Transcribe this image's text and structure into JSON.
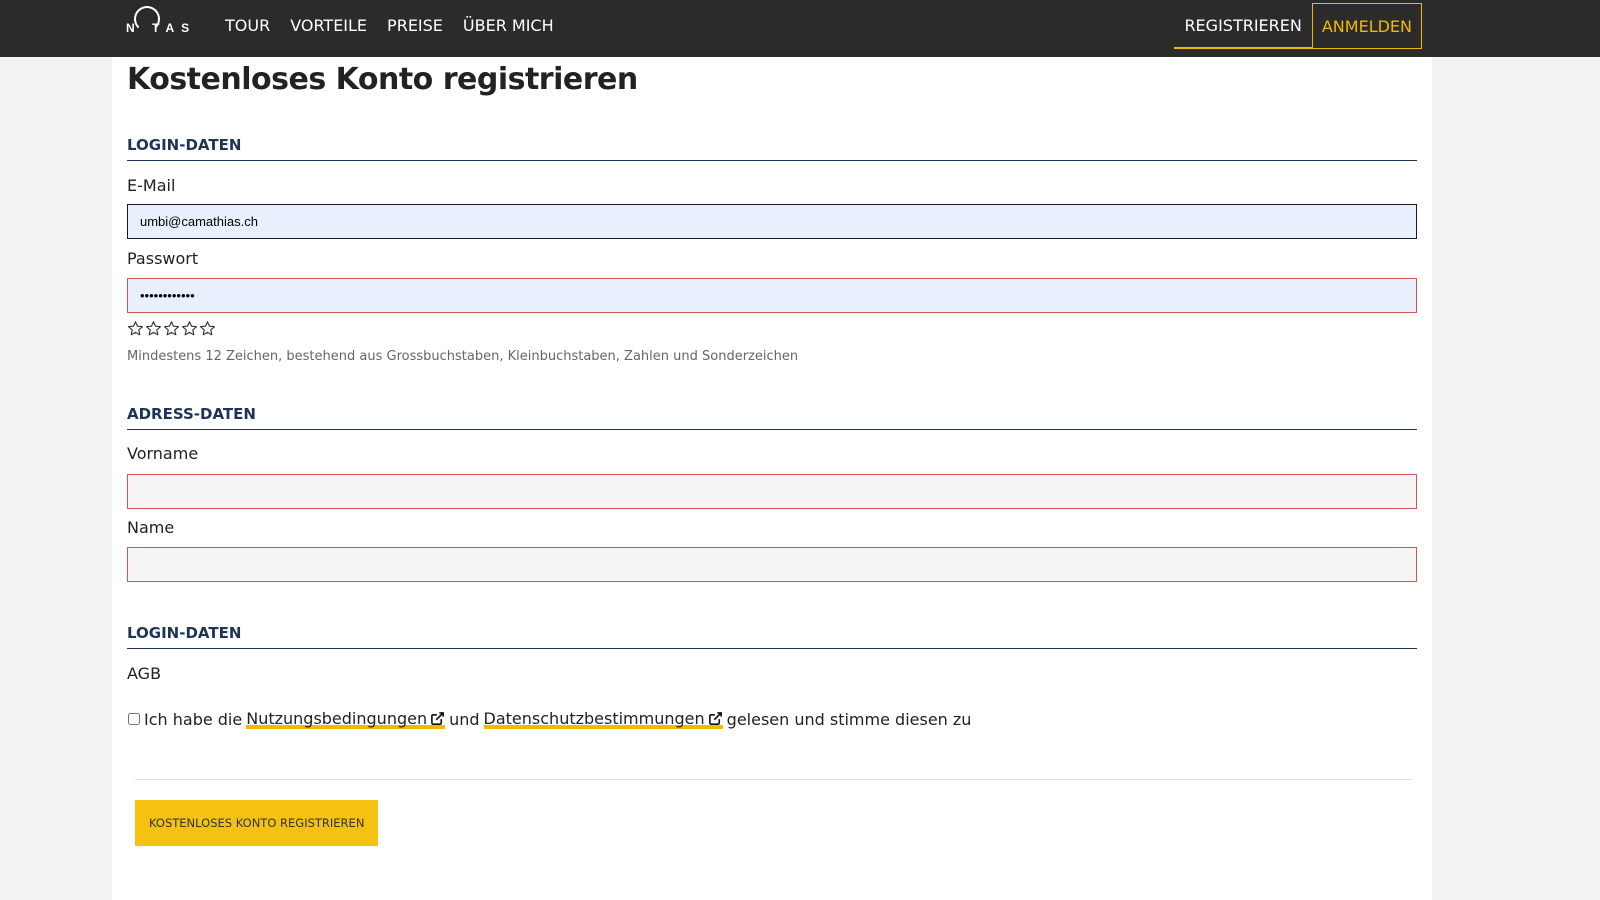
{
  "header": {
    "logo_text": "N TAS",
    "nav": [
      {
        "label": "TOUR"
      },
      {
        "label": "VORTEILE"
      },
      {
        "label": "PREISE"
      },
      {
        "label": "ÜBER MICH"
      }
    ],
    "register_label": "REGISTRIEREN",
    "login_label": "ANMELDEN"
  },
  "page": {
    "title": "Kostenloses Konto registrieren"
  },
  "login_section": {
    "heading": "LOGIN-DATEN",
    "email_label": "E-Mail",
    "email_value": "umbi@camathias.ch",
    "password_label": "Passwort",
    "password_value": "••••••••••••",
    "password_rating": 0,
    "password_rating_max": 5,
    "password_hint": "Mindestens 12 Zeichen, bestehend aus Grossbuchstaben, Kleinbuchstaben, Zahlen und Sonderzeichen"
  },
  "address_section": {
    "heading": "ADRESS-DATEN",
    "firstname_label": "Vorname",
    "firstname_value": "",
    "lastname_label": "Name",
    "lastname_value": ""
  },
  "terms_section": {
    "heading": "LOGIN-DATEN",
    "agb_label": "AGB",
    "text_before": "Ich habe die",
    "link_terms": "Nutzungsbedingungen",
    "text_and": "und",
    "link_privacy": "Datenschutzbestimmungen",
    "text_after": "gelesen und stimme diesen zu",
    "checked": false
  },
  "submit_label": "KOSTENLOSES KONTO REGISTRIEREN",
  "colors": {
    "topbar": "#2b2b2b",
    "accent": "#f5b800",
    "heading_blue": "#1c3556",
    "error_border": "#d9534f"
  }
}
